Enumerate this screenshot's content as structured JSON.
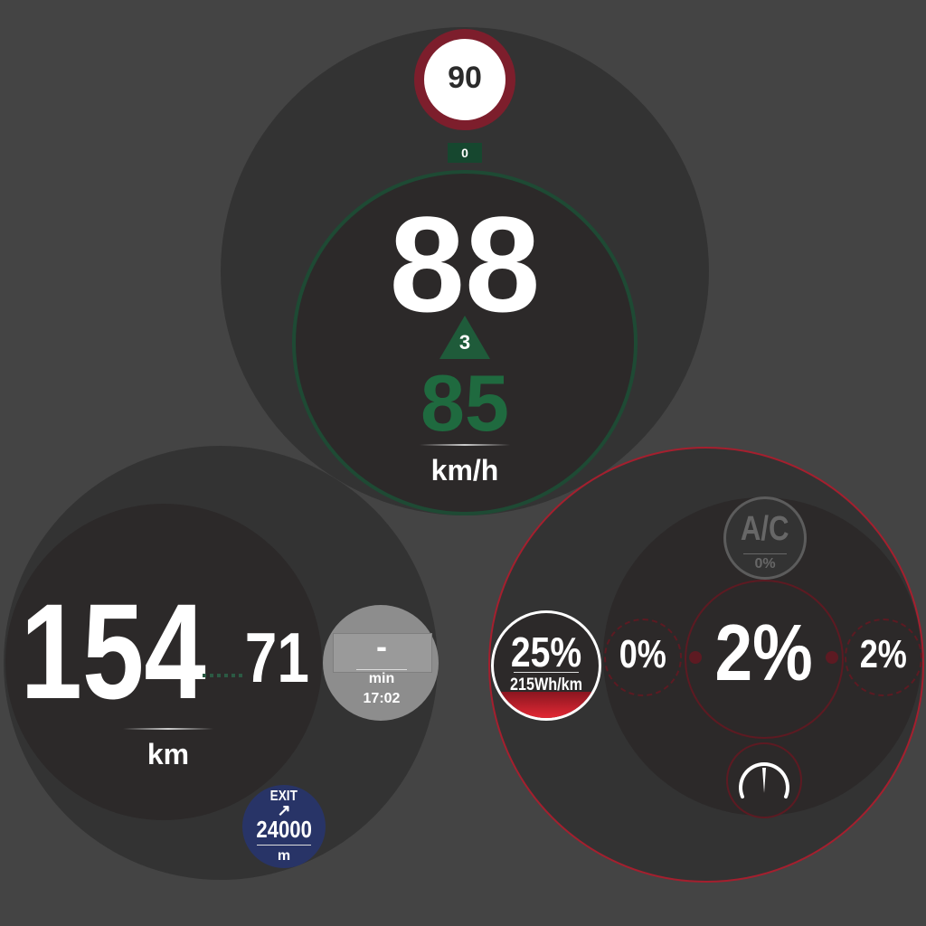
{
  "speed": {
    "limit": "90",
    "offset": "0",
    "current": "88",
    "delta": "3",
    "target": "85",
    "unit": "km/h"
  },
  "range": {
    "primary": "154",
    "secondary": "71",
    "unit": "km",
    "time_value": "-",
    "time_unit": "min",
    "time_clock": "17:02",
    "exit_label": "EXIT",
    "exit_arrow": "↗",
    "exit_distance": "24000",
    "exit_unit": "m"
  },
  "energy": {
    "ac_label": "A/C",
    "ac_value": "0%",
    "soc": "25%",
    "soc_fraction": 0.25,
    "consumption": "215Wh/km",
    "left_power": "0%",
    "main_power": "2%",
    "right_power": "2%",
    "gauge_icon": "speedometer-gauge-icon"
  },
  "colors": {
    "background": "#444444",
    "panel": "#333333",
    "inner_panel": "#2c2929",
    "speed_accent": "#1f6a3f",
    "speed_limit_red": "#7d1e2c",
    "energy_red": "#a51f2e",
    "exit_blue": "#283467"
  }
}
